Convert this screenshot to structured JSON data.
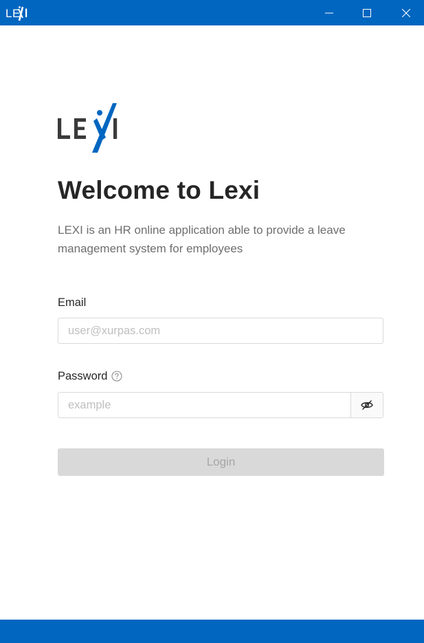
{
  "window": {
    "brand_logo": "LEXI",
    "minimize_icon": "minimize-icon",
    "maximize_icon": "maximize-icon",
    "close_icon": "close-icon"
  },
  "brand": {
    "logo_text": "LEXI",
    "primary_color": "#0066c0",
    "text_color": "#3a3a3a"
  },
  "main": {
    "title": "Welcome to Lexi",
    "description": "LEXI is an HR online application able to provide a leave management system for employees"
  },
  "form": {
    "email_label": "Email",
    "email_placeholder": "user@xurpas.com",
    "email_value": "",
    "password_label": "Password",
    "password_placeholder": "example",
    "password_value": "",
    "help_icon": "question-circle-icon",
    "visibility_icon": "eye-invisible-icon",
    "login_label": "Login"
  }
}
